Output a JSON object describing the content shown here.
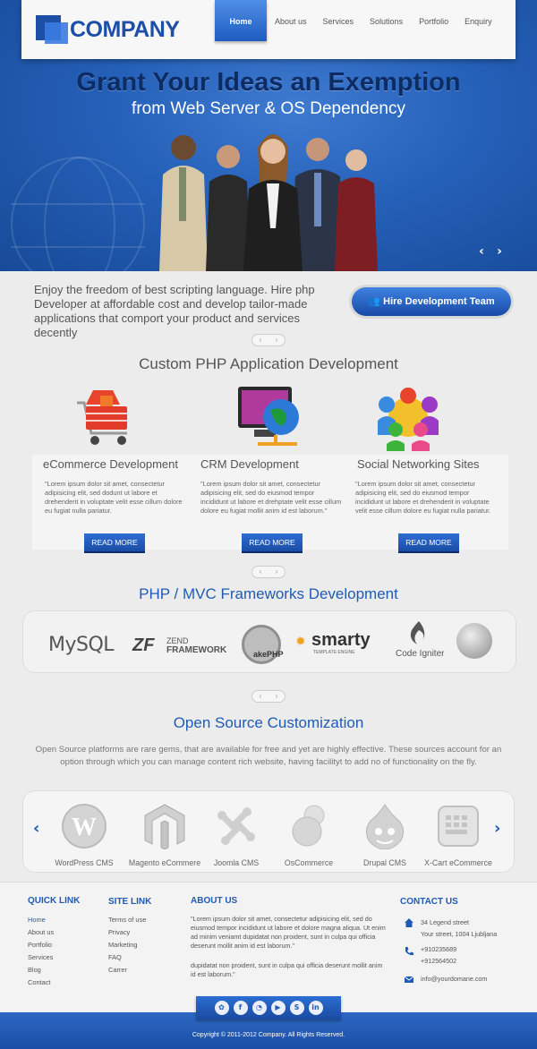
{
  "brand": {
    "name": "COMPANY"
  },
  "nav": [
    {
      "label": "Home",
      "active": true
    },
    {
      "label": "About us"
    },
    {
      "label": "Services"
    },
    {
      "label": "Solutions"
    },
    {
      "label": "Portfolio"
    },
    {
      "label": "Enquiry"
    }
  ],
  "hero": {
    "title": "Grant Your Ideas an Exemption",
    "subtitle": "from Web Server & OS Dependency",
    "prev": "‹",
    "next": "›"
  },
  "intro": {
    "text": "Enjoy the freedom of best scripting language. Hire php Developer at affordable cost and develop tailor-made applications that comport your product and services decently",
    "button": "Hire Development Team"
  },
  "pager": {
    "prev": "‹",
    "next": "›"
  },
  "custom": {
    "title": "Custom PHP Application Development",
    "cards": [
      {
        "icon": "shopping-cart-icon",
        "title": "eCommerce Development",
        "text": "\"Lorem ipsum dolor sit amet, consectetur adipisicing elit, sed dodunt ut labore et drehenderit in voluptate velit esse cillum dolore eu fugiat nulla pariatur.",
        "button": "READ MORE"
      },
      {
        "icon": "monitor-globe-icon",
        "title": "CRM Development",
        "text": "\"Lorem ipsum dolor sit amet, consectetur adipisicing elit, sed do eiusmod tempor incididunt ut labore et drehptate velit esse cillum dolore eu fugiat mollit anim id est laborum.\"",
        "button": "READ MORE"
      },
      {
        "icon": "people-network-icon",
        "title": "Social Networking Sites",
        "text": "\"Lorem ipsum dolor sit amet, consectetur adipisicing elit, sed do eiusmod tempor incididunt ut labore et drehenderit in voluptate velit esse cillum dolore eu fugiat nulla pariatur.",
        "button": "READ MORE"
      }
    ]
  },
  "frameworks": {
    "title": "PHP / MVC Frameworks Development",
    "items": [
      {
        "name": "MySQL",
        "icon": "mysql-logo"
      },
      {
        "name": "ZEND",
        "sub": "FRAMEWORK",
        "icon": "zend-logo"
      },
      {
        "name": "akePHP",
        "icon": "cakephp-logo"
      },
      {
        "name": "smarty",
        "sub": "TEMPLATE ENGINE",
        "icon": "smarty-logo"
      },
      {
        "name": "Code Igniter",
        "icon": "codeigniter-logo"
      },
      {
        "name": "",
        "icon": "symfony-logo"
      }
    ]
  },
  "opensource": {
    "title": "Open Source Customization",
    "text": "Open Source platforms are rare gems, that are available for free and yet are highly effective. These sources account for an option through which you can manage content rich website, having facilityt to add no of functionality on the fly.",
    "prev": "‹",
    "next": "›",
    "items": [
      {
        "label": "WordPress CMS",
        "icon": "wordpress-icon"
      },
      {
        "label": "Magento eCommere",
        "icon": "magento-icon"
      },
      {
        "label": "Joomla CMS",
        "icon": "joomla-icon"
      },
      {
        "label": "OsCommerce",
        "icon": "oscommerce-icon"
      },
      {
        "label": "Drupal CMS",
        "icon": "drupal-icon"
      },
      {
        "label": "X-Cart eCommerce",
        "icon": "xcart-icon"
      }
    ]
  },
  "footer": {
    "quick_link": {
      "title": "QUICK LINK",
      "items": [
        "Home",
        "About us",
        "Portfolio",
        "Services",
        "Blog",
        "Contact"
      ]
    },
    "site_link": {
      "title": "SITE LINK",
      "items": [
        "Terms of use",
        "Privacy",
        "Marketing",
        "FAQ",
        "Carrer"
      ]
    },
    "about": {
      "title": "ABOUT US",
      "p1": "\"Lorem ipsum dolor sit amet, consectetur adipisicing elit, sed do eiusmod tempor incididunt ut labore et dolore magna aliqua. Ut enim ad minim veniamt dupidatat non proident, sunt in culpa qui officia deserunt mollit anim id est laborum.\"",
      "p2": "dupidatat non proident, sunt in culpa qui officia deserunt mollit anim id est laborum.\""
    },
    "contact": {
      "title": "CONTACT US",
      "address1": "34 Legend street",
      "address2": "Your street, 1004 Ljubljana",
      "phone1": "+910235689",
      "phone2": "+912564502",
      "email": "info@yourdomane.com"
    },
    "social": [
      "twitter-icon",
      "facebook-icon",
      "rss-icon",
      "youtube-icon",
      "skype-icon",
      "linkedin-icon"
    ],
    "copyright": "Copyright © 2011-2012 Company. All Rights Reserved."
  },
  "colors": {
    "brand_blue": "#1f5bb5",
    "nav_active": "#2f6fd2"
  }
}
